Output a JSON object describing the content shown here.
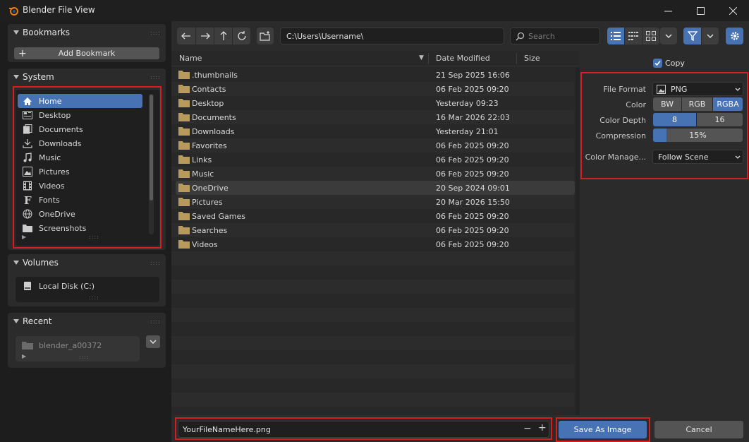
{
  "window": {
    "title": "Blender File View"
  },
  "sidebar": {
    "bookmarks": {
      "header": "Bookmarks",
      "add_label": "Add Bookmark"
    },
    "system": {
      "header": "System",
      "items": [
        {
          "label": "Home",
          "icon": "home-icon"
        },
        {
          "label": "Desktop",
          "icon": "desktop-icon"
        },
        {
          "label": "Documents",
          "icon": "documents-icon"
        },
        {
          "label": "Downloads",
          "icon": "download-icon"
        },
        {
          "label": "Music",
          "icon": "music-icon"
        },
        {
          "label": "Pictures",
          "icon": "image-icon"
        },
        {
          "label": "Videos",
          "icon": "film-icon"
        },
        {
          "label": "Fonts",
          "icon": "font-icon"
        },
        {
          "label": "OneDrive",
          "icon": "globe-icon"
        },
        {
          "label": "Screenshots",
          "icon": "folder-icon"
        }
      ]
    },
    "volumes": {
      "header": "Volumes",
      "items": [
        {
          "label": "Local Disk (C:)",
          "icon": "disk-icon"
        }
      ]
    },
    "recent": {
      "header": "Recent",
      "items": [
        {
          "label": "blender_a00372",
          "icon": "folder-icon"
        }
      ]
    }
  },
  "toolbar": {
    "path": "C:\\Users\\Username\\",
    "search_placeholder": "Search"
  },
  "filelist": {
    "columns": {
      "name": "Name",
      "date": "Date Modified",
      "size": "Size"
    },
    "rows": [
      {
        "name": ".thumbnails",
        "date": "21 Sep 2025 16:06"
      },
      {
        "name": "Contacts",
        "date": "06 Feb 2025 09:20"
      },
      {
        "name": "Desktop",
        "date": "Yesterday 09:23"
      },
      {
        "name": "Documents",
        "date": "16 Mar 2026 22:03"
      },
      {
        "name": "Downloads",
        "date": "Yesterday 21:01"
      },
      {
        "name": "Favorites",
        "date": "06 Feb 2025 09:20"
      },
      {
        "name": "Links",
        "date": "06 Feb 2025 09:20"
      },
      {
        "name": "Music",
        "date": "06 Feb 2025 09:20"
      },
      {
        "name": "OneDrive",
        "date": "20 Sep 2024 09:01"
      },
      {
        "name": "Pictures",
        "date": "20 Mar 2026 15:50"
      },
      {
        "name": "Saved Games",
        "date": "06 Feb 2025 09:20"
      },
      {
        "name": "Searches",
        "date": "06 Feb 2025 09:20"
      },
      {
        "name": "Videos",
        "date": "06 Feb 2025 09:20"
      }
    ],
    "selected_index": 8
  },
  "settings": {
    "copy_label": "Copy",
    "copy_checked": true,
    "file_format": {
      "label": "File Format",
      "value": "PNG"
    },
    "color": {
      "label": "Color",
      "options": [
        "BW",
        "RGB",
        "RGBA"
      ],
      "selected": "RGBA"
    },
    "color_depth": {
      "label": "Color Depth",
      "options": [
        "8",
        "16"
      ],
      "selected": "8"
    },
    "compression": {
      "label": "Compression",
      "value": "15%",
      "fraction": 0.15
    },
    "color_management": {
      "label": "Color Manage...",
      "value": "Follow Scene"
    }
  },
  "footer": {
    "filename": "YourFileNameHere.png",
    "save_label": "Save As Image",
    "cancel_label": "Cancel"
  },
  "colors": {
    "accent": "#4772b3",
    "highlight_box": "#d31f1f",
    "folder": "#b89a5a"
  }
}
